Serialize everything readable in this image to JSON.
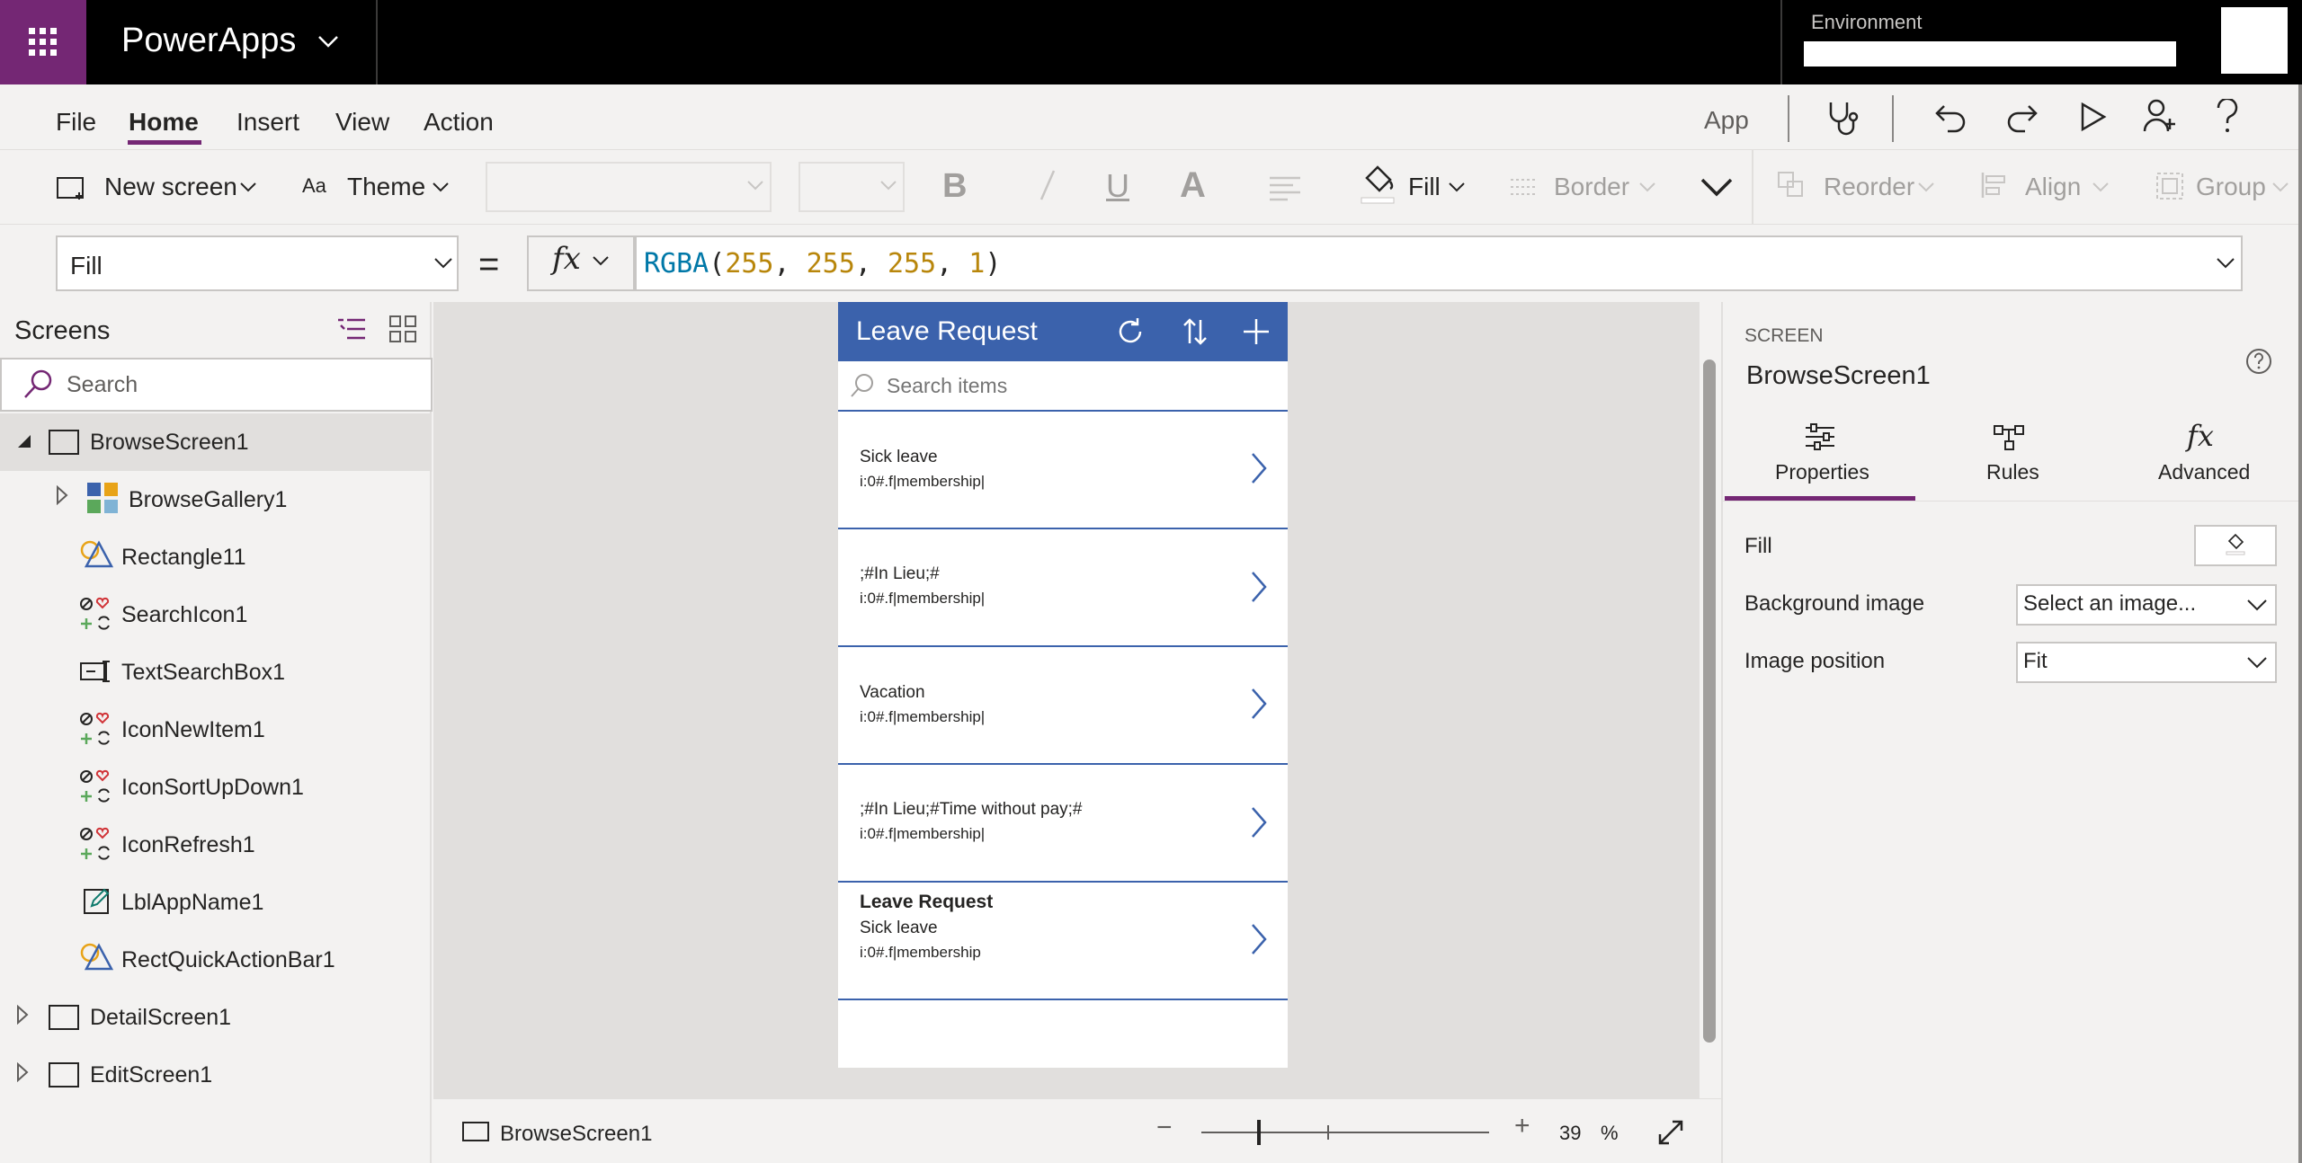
{
  "title_bar": {
    "app_name": "PowerApps",
    "environment_label": "Environment"
  },
  "menu": {
    "items": [
      "File",
      "Home",
      "Insert",
      "View",
      "Action"
    ],
    "app_label": "App"
  },
  "ribbon": {
    "new_screen": "New screen",
    "theme": "Theme",
    "fill": "Fill",
    "border": "Border",
    "reorder": "Reorder",
    "align": "Align",
    "group": "Group"
  },
  "formula_bar": {
    "property": "Fill",
    "equals": "=",
    "formula": {
      "fn": "RGBA",
      "args": [
        "255",
        "255",
        "255",
        "1"
      ]
    }
  },
  "tree": {
    "title": "Screens",
    "search_placeholder": "Search",
    "items": [
      {
        "label": "BrowseScreen1"
      },
      {
        "label": "BrowseGallery1"
      },
      {
        "label": "Rectangle11"
      },
      {
        "label": "SearchIcon1"
      },
      {
        "label": "TextSearchBox1"
      },
      {
        "label": "IconNewItem1"
      },
      {
        "label": "IconSortUpDown1"
      },
      {
        "label": "IconRefresh1"
      },
      {
        "label": "LblAppName1"
      },
      {
        "label": "RectQuickActionBar1"
      },
      {
        "label": "DetailScreen1"
      },
      {
        "label": "EditScreen1"
      }
    ]
  },
  "phone": {
    "title": "Leave Request",
    "search_placeholder": "Search items",
    "gallery": [
      {
        "title": "Sick leave",
        "sub": "i:0#.f|membership|"
      },
      {
        "title": ";#In Lieu;#",
        "sub": "i:0#.f|membership|"
      },
      {
        "title": "Vacation",
        "sub": "i:0#.f|membership|"
      },
      {
        "title": ";#In Lieu;#Time without pay;#",
        "sub": "i:0#.f|membership|"
      },
      {
        "heading": "Leave Request",
        "title": "Sick leave",
        "sub": "i:0#.f|membership"
      }
    ]
  },
  "status_bar": {
    "screen_name": "BrowseScreen1",
    "zoom": "39",
    "zoom_unit": "%"
  },
  "right_panel": {
    "section_label": "SCREEN",
    "screen_name": "BrowseScreen1",
    "tabs": [
      "Properties",
      "Rules",
      "Advanced"
    ],
    "props": {
      "fill_label": "Fill",
      "bg_image_label": "Background image",
      "bg_image_value": "Select an image...",
      "image_position_label": "Image position",
      "image_position_value": "Fit"
    }
  },
  "colors": {
    "accent": "#742774",
    "header_blue": "#3b62ac"
  }
}
